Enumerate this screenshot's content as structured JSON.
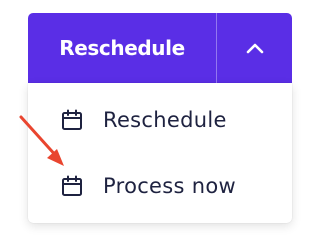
{
  "colors": {
    "accent": "#5a2ee6",
    "menu_text": "#1e2240",
    "annotation_arrow": "#e9452f"
  },
  "split_button": {
    "label": "Reschedule",
    "toggle_icon": "chevron-up-icon"
  },
  "menu": {
    "items": [
      {
        "label": "Reschedule",
        "icon": "calendar-icon"
      },
      {
        "label": "Process now",
        "icon": "calendar-icon"
      }
    ]
  },
  "annotation": {
    "icon": "red-arrow-icon",
    "points_to": "Process now"
  }
}
